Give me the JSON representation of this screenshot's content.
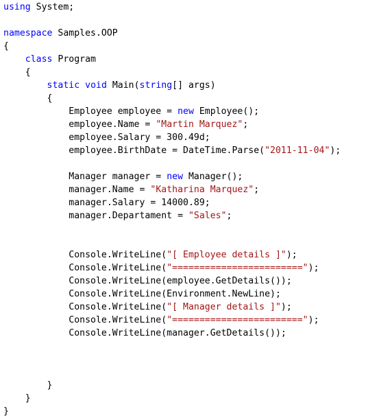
{
  "colors": {
    "background": "#ffffff",
    "keyword": "#0000ff",
    "string": "#a31515",
    "plain": "#000000"
  },
  "editor": {
    "lines": [
      [
        {
          "t": "kw",
          "v": "using"
        },
        {
          "t": "plain",
          "v": " System;"
        }
      ],
      [],
      [
        {
          "t": "kw",
          "v": "namespace"
        },
        {
          "t": "plain",
          "v": " Samples.OOP"
        }
      ],
      [
        {
          "t": "plain",
          "v": "{"
        }
      ],
      [
        {
          "t": "plain",
          "v": "    "
        },
        {
          "t": "kw",
          "v": "class"
        },
        {
          "t": "plain",
          "v": " Program"
        }
      ],
      [
        {
          "t": "plain",
          "v": "    {"
        }
      ],
      [
        {
          "t": "plain",
          "v": "        "
        },
        {
          "t": "kw",
          "v": "static"
        },
        {
          "t": "plain",
          "v": " "
        },
        {
          "t": "kw",
          "v": "void"
        },
        {
          "t": "plain",
          "v": " Main("
        },
        {
          "t": "kw",
          "v": "string"
        },
        {
          "t": "plain",
          "v": "[] args)"
        }
      ],
      [
        {
          "t": "plain",
          "v": "        {"
        }
      ],
      [
        {
          "t": "plain",
          "v": "            Employee employee = "
        },
        {
          "t": "kw",
          "v": "new"
        },
        {
          "t": "plain",
          "v": " Employee();"
        }
      ],
      [
        {
          "t": "plain",
          "v": "            employee.Name = "
        },
        {
          "t": "str",
          "v": "\"Martin Marquez\""
        },
        {
          "t": "plain",
          "v": ";"
        }
      ],
      [
        {
          "t": "plain",
          "v": "            employee.Salary = 300.49d;"
        }
      ],
      [
        {
          "t": "plain",
          "v": "            employee.BirthDate = DateTime.Parse("
        },
        {
          "t": "str",
          "v": "\"2011-11-04\""
        },
        {
          "t": "plain",
          "v": ");"
        }
      ],
      [],
      [
        {
          "t": "plain",
          "v": "            Manager manager = "
        },
        {
          "t": "kw",
          "v": "new"
        },
        {
          "t": "plain",
          "v": " Manager();"
        }
      ],
      [
        {
          "t": "plain",
          "v": "            manager.Name = "
        },
        {
          "t": "str",
          "v": "\"Katharina Marquez\""
        },
        {
          "t": "plain",
          "v": ";"
        }
      ],
      [
        {
          "t": "plain",
          "v": "            manager.Salary = 14000.89;"
        }
      ],
      [
        {
          "t": "plain",
          "v": "            manager.Departament = "
        },
        {
          "t": "str",
          "v": "\"Sales\""
        },
        {
          "t": "plain",
          "v": ";"
        }
      ],
      [],
      [],
      [
        {
          "t": "plain",
          "v": "            Console.WriteLine("
        },
        {
          "t": "str",
          "v": "\"[ Employee details ]\""
        },
        {
          "t": "plain",
          "v": ");"
        }
      ],
      [
        {
          "t": "plain",
          "v": "            Console.WriteLine("
        },
        {
          "t": "str",
          "v": "\"========================\""
        },
        {
          "t": "plain",
          "v": ");"
        }
      ],
      [
        {
          "t": "plain",
          "v": "            Console.WriteLine(employee.GetDetails());"
        }
      ],
      [
        {
          "t": "plain",
          "v": "            Console.WriteLine(Environment.NewLine);"
        }
      ],
      [
        {
          "t": "plain",
          "v": "            Console.WriteLine("
        },
        {
          "t": "str",
          "v": "\"[ Manager details ]\""
        },
        {
          "t": "plain",
          "v": ");"
        }
      ],
      [
        {
          "t": "plain",
          "v": "            Console.WriteLine("
        },
        {
          "t": "str",
          "v": "\"========================\""
        },
        {
          "t": "plain",
          "v": ");"
        }
      ],
      [
        {
          "t": "plain",
          "v": "            Console.WriteLine(manager.GetDetails());"
        }
      ],
      [],
      [],
      [],
      [
        {
          "t": "plain",
          "v": "        }"
        }
      ],
      [
        {
          "t": "plain",
          "v": "    }"
        }
      ],
      [
        {
          "t": "plain",
          "v": "}"
        }
      ]
    ]
  }
}
